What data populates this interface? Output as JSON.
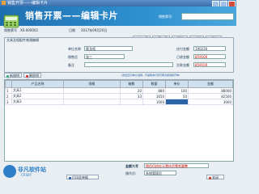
{
  "window": {
    "title": "销售开票——编辑卡片"
  },
  "banner": {
    "title": "销售开票——编辑卡片",
    "bill_no_label": "销售票号:",
    "bill_no_value": ""
  },
  "header": {
    "bill_no_label": "销售票号",
    "bill_no_value": "XS-000002",
    "date_label": "日期",
    "date_value": "2017年09月20日"
  },
  "toolbar": {
    "prev": "上一条",
    "next": "下一条",
    "delete": "删除",
    "new": "新增",
    "save": "保存"
  },
  "panel": {
    "title": "文具及相配件普通编辑",
    "unit_label": "单位名称",
    "unit_value": "蔡龙喧",
    "sales_label": "销售员",
    "sales_value": "张三",
    "note_label": "备注",
    "note_value": "",
    "receivable_label": "应付金额",
    "receivable_value": "190230",
    "paid_label": "已收金额",
    "paid_value": "859100",
    "owed_label": "欠款金额",
    "owed_value": "859100"
  },
  "grid_toolbar": {
    "add": "新增明细",
    "remove": "删除明细",
    "hint": "(双击显示单价/选择...不编辑本行则可再次使用新开单)"
  },
  "grid": {
    "columns": [
      "",
      "产品名称",
      "规格",
      "箱数",
      "数量",
      "单价",
      "金额"
    ],
    "rows": [
      {
        "idx": "1",
        "name": "文具1",
        "spec": "",
        "box": "20",
        "qty": "880",
        "price": "100",
        "amount": "88000"
      },
      {
        "idx": "2",
        "name": "文具2",
        "spec": "",
        "box": "33",
        "qty": "1650",
        "price": "50",
        "amount": "82500"
      },
      {
        "idx": "3",
        "name": "文具3",
        "spec": "",
        "box": "",
        "qty": "1000",
        "price": "",
        "amount": "3000"
      }
    ]
  },
  "footer": {
    "total_label": "金额大写",
    "total_value": "捌佰伍拾玖元零玖佰零贰圆整",
    "operator_label": "操作员:",
    "operator_value": "系统管理员",
    "print_label": "打印此单据",
    "close_label": "关闭"
  },
  "watermark": {
    "text": "非凡软件站",
    "sub": "CRSKY"
  }
}
